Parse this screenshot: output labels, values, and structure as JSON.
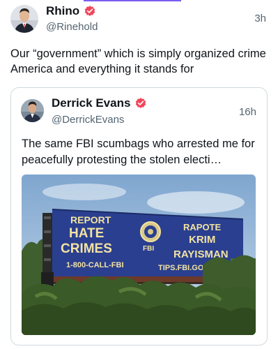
{
  "post": {
    "author": {
      "name": "Rhino",
      "handle": "@Rinehold",
      "time": "3h"
    },
    "text": "Our “government” which is simply organized crime America and everything it stands for",
    "quote": {
      "author": {
        "name": "Derrick Evans",
        "handle": "@DerrickEvans",
        "time": "16h"
      },
      "text": "The same FBI scumbags who arrested me for peacefully protesting the stolen electi…",
      "image": {
        "billboard": {
          "left_lines": [
            "REPORT",
            "HATE",
            "CRIMES"
          ],
          "right_lines": [
            "RAPOTE",
            "KRIM",
            "RAYISMAN"
          ],
          "seal_label": "FBI",
          "phone": "1-800-CALL-FBI",
          "url": "TIPS.FBI.GOV"
        }
      }
    }
  },
  "colors": {
    "accent": "#7b5cf0",
    "verified_badge": "#f0465c",
    "billboard_bg": "#2a3f8f",
    "billboard_text": "#f2e3a2"
  },
  "icons": {
    "verified": "verified-badge-icon"
  }
}
